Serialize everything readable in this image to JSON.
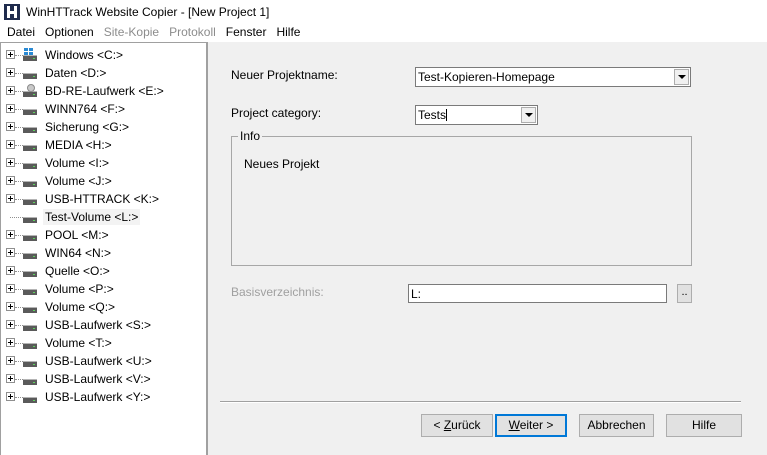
{
  "window": {
    "title": "WinHTTrack Website Copier - [New Project 1]"
  },
  "menu": {
    "items": [
      {
        "label": "Datei",
        "enabled": true
      },
      {
        "label": "Optionen",
        "enabled": true
      },
      {
        "label": "Site-Kopie",
        "enabled": false
      },
      {
        "label": "Protokoll",
        "enabled": false
      },
      {
        "label": "Fenster",
        "enabled": true
      },
      {
        "label": "Hilfe",
        "enabled": true
      }
    ]
  },
  "tree": {
    "items": [
      {
        "label": "Windows <C:>",
        "icon": "windows-drive-icon",
        "expandable": true
      },
      {
        "label": "Daten <D:>",
        "icon": "hard-drive-icon",
        "expandable": true
      },
      {
        "label": "BD-RE-Laufwerk <E:>",
        "icon": "optical-drive-icon",
        "expandable": true
      },
      {
        "label": "WINN764 <F:>",
        "icon": "hard-drive-icon",
        "expandable": true
      },
      {
        "label": "Sicherung <G:>",
        "icon": "hard-drive-icon",
        "expandable": true
      },
      {
        "label": "MEDIA <H:>",
        "icon": "hard-drive-icon",
        "expandable": true
      },
      {
        "label": "Volume <I:>",
        "icon": "hard-drive-icon",
        "expandable": true
      },
      {
        "label": "Volume <J:>",
        "icon": "hard-drive-icon",
        "expandable": true
      },
      {
        "label": "USB-HTTRACK <K:>",
        "icon": "hard-drive-icon",
        "expandable": true
      },
      {
        "label": "Test-Volume <L:>",
        "icon": "hard-drive-icon",
        "expandable": false,
        "selected": true
      },
      {
        "label": "POOL <M:>",
        "icon": "hard-drive-icon",
        "expandable": true
      },
      {
        "label": "WIN64 <N:>",
        "icon": "hard-drive-icon",
        "expandable": true
      },
      {
        "label": "Quelle <O:>",
        "icon": "hard-drive-icon",
        "expandable": true
      },
      {
        "label": "Volume <P:>",
        "icon": "hard-drive-icon",
        "expandable": true
      },
      {
        "label": "Volume <Q:>",
        "icon": "hard-drive-icon",
        "expandable": true
      },
      {
        "label": "USB-Laufwerk <S:>",
        "icon": "hard-drive-icon",
        "expandable": true
      },
      {
        "label": "Volume <T:>",
        "icon": "hard-drive-icon",
        "expandable": true
      },
      {
        "label": "USB-Laufwerk <U:>",
        "icon": "hard-drive-icon",
        "expandable": true
      },
      {
        "label": "USB-Laufwerk <V:>",
        "icon": "hard-drive-icon",
        "expandable": true
      },
      {
        "label": "USB-Laufwerk <Y:>",
        "icon": "hard-drive-icon",
        "expandable": true
      }
    ]
  },
  "form": {
    "project_name_label": "Neuer Projektname:",
    "project_name_value": "Test-Kopieren-Homepage",
    "category_label": "Project category:",
    "category_value": "Tests",
    "info_title": "Info",
    "info_text": "Neues Projekt",
    "base_dir_label": "Basisverzeichnis:",
    "base_dir_value": "L:",
    "browse_label": ".."
  },
  "buttons": {
    "back_prefix": "< ",
    "back_mnemonic": "Z",
    "back_rest": "urück",
    "next_mnemonic": "W",
    "next_rest": "eiter >",
    "cancel": "Abbrechen",
    "help": "Hilfe"
  }
}
